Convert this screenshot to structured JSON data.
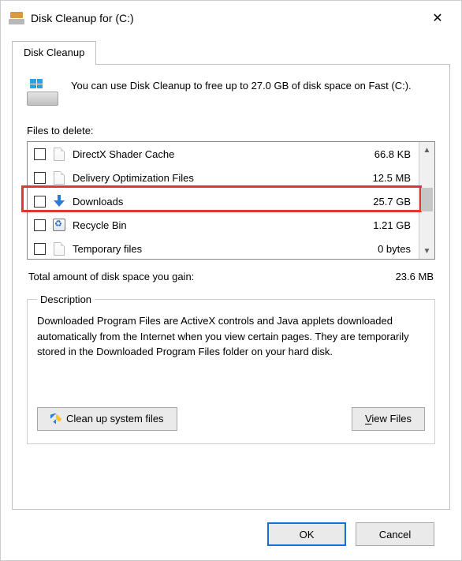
{
  "window": {
    "title": "Disk Cleanup for  (C:)"
  },
  "tab": {
    "label": "Disk Cleanup"
  },
  "intro": "You can use Disk Cleanup to free up to 27.0 GB of disk space on Fast (C:).",
  "files": {
    "label": "Files to delete:",
    "items": [
      {
        "name": "DirectX Shader Cache",
        "size": "66.8 KB",
        "icon": "page",
        "checked": false
      },
      {
        "name": "Delivery Optimization Files",
        "size": "12.5 MB",
        "icon": "page",
        "checked": false
      },
      {
        "name": "Downloads",
        "size": "25.7 GB",
        "icon": "download",
        "checked": false,
        "highlighted": true
      },
      {
        "name": "Recycle Bin",
        "size": "1.21 GB",
        "icon": "recycle",
        "checked": false
      },
      {
        "name": "Temporary files",
        "size": "0 bytes",
        "icon": "page",
        "checked": false
      }
    ]
  },
  "total": {
    "label": "Total amount of disk space you gain:",
    "value": "23.6 MB"
  },
  "description": {
    "legend": "Description",
    "text": "Downloaded Program Files are ActiveX controls and Java applets downloaded automatically from the Internet when you view certain pages. They are temporarily stored in the Downloaded Program Files folder on your hard disk."
  },
  "buttons": {
    "clean_system": "Clean up system files",
    "view_files": "View Files",
    "ok": "OK",
    "cancel": "Cancel"
  }
}
